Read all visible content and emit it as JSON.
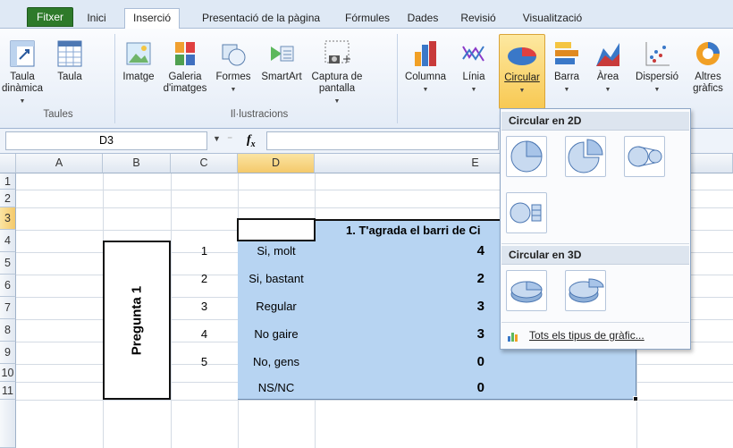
{
  "tabs": [
    {
      "label": "Fitxer"
    },
    {
      "label": "Inici"
    },
    {
      "label": "Inserció"
    },
    {
      "label": "Presentació de la pàgina"
    },
    {
      "label": "Fórmules"
    },
    {
      "label": "Dades"
    },
    {
      "label": "Revisió"
    },
    {
      "label": "Visualització"
    }
  ],
  "ribbon": {
    "taula_dinamica": "Taula dinàmica",
    "taula": "Taula",
    "imatge": "Imatge",
    "galeria": "Galeria d'imatges",
    "formes": "Formes",
    "smartart": "SmartArt",
    "captura": "Captura de pantalla",
    "columna": "Columna",
    "linia": "Línia",
    "circular": "Circular",
    "barra": "Barra",
    "area": "Àrea",
    "dispersio": "Dispersió",
    "altres": "Altres gràfics",
    "group_taules": "Taules",
    "group_il": "Il·lustracions"
  },
  "formula": {
    "namebox": "D3",
    "fx": "fx"
  },
  "columns": [
    "A",
    "B",
    "C",
    "D",
    "E"
  ],
  "rows": [
    "1",
    "2",
    "3",
    "4",
    "5",
    "6",
    "7",
    "8",
    "9",
    "10",
    "11"
  ],
  "sheet": {
    "header_e": "1. T'agrada el barri de Ci",
    "pregunta": "Pregunta 1",
    "numbers": [
      "1",
      "2",
      "3",
      "4",
      "5"
    ],
    "answers": [
      "Si, molt",
      "Si, bastant",
      "Regular",
      "No gaire",
      "No, gens",
      "NS/NC"
    ],
    "values": [
      "4",
      "2",
      "3",
      "3",
      "0",
      "0"
    ]
  },
  "dropdown": {
    "head2d": "Circular en 2D",
    "head3d": "Circular en 3D",
    "all_types": "Tots els tipus de gràfic..."
  },
  "colors": {
    "accent_blue": "#b7d4f2",
    "file_tab": "#2e7a2a",
    "selected": "#f8c953"
  }
}
